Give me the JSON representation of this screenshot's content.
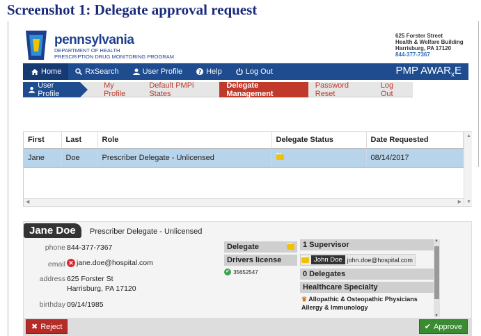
{
  "doc_title": "Screenshot 1: Delegate approval request",
  "header": {
    "brand_name": "pennsylvania",
    "brand_dept_1": "DEPARTMENT OF HEALTH",
    "brand_dept_2": "PRESCRIPTION DRUG MONITORING PROGRAM",
    "address_1": "625 Forster Street",
    "address_2": "Health & Welfare Building",
    "address_3": "Harrisburg, PA 17120",
    "address_phone": "844-377-7367"
  },
  "nav": {
    "home": "Home",
    "rxsearch": "RxSearch",
    "user_profile": "User Profile",
    "help": "Help",
    "logout": "Log Out",
    "brand_main": "PMP AWAR",
    "brand_sub": "x",
    "brand_end": "E"
  },
  "subnav": {
    "current": "User Profile",
    "tabs": [
      "My Profile",
      "Default PMPi States",
      "Delegate Management",
      "Password Reset",
      "Log Out"
    ],
    "selected_index": 2
  },
  "table": {
    "headers": [
      "First",
      "Last",
      "Role",
      "Delegate Status",
      "Date Requested"
    ],
    "rows": [
      {
        "first": "Jane",
        "last": "Doe",
        "role": "Prescriber Delegate - Unlicensed",
        "status": "pending",
        "date": "08/14/2017"
      }
    ]
  },
  "detail": {
    "name": "Jane Doe",
    "role": "Prescriber Delegate - Unlicensed",
    "labels": {
      "phone": "phone",
      "email": "email",
      "address": "address",
      "birthday": "birthday"
    },
    "phone": "844-377-7367",
    "email": "jane.doe@hospital.com",
    "address_1": "625 Forster St",
    "address_2": "Harrisburg, PA 17120",
    "birthday": "09/14/1985",
    "delegate_label": "Delegate",
    "drivers_license_label": "Drivers license",
    "drivers_license": "35652547",
    "supervisors_header": "1 Supervisor",
    "supervisor_name": "John Doe",
    "supervisor_email": "john.doe@hospital.com",
    "delegates_header": "0 Delegates",
    "specialty_header": "Healthcare Specialty",
    "specialty_1": "Allopathic & Osteopathic Physicians",
    "specialty_2": "Allergy & Immunology"
  },
  "actions": {
    "reject": "Reject",
    "approve": "Approve"
  },
  "colors": {
    "nav_blue": "#1e4c8f",
    "accent_red": "#c0392b",
    "approve_green": "#3a8b32",
    "pending_yellow": "#f2c200"
  }
}
